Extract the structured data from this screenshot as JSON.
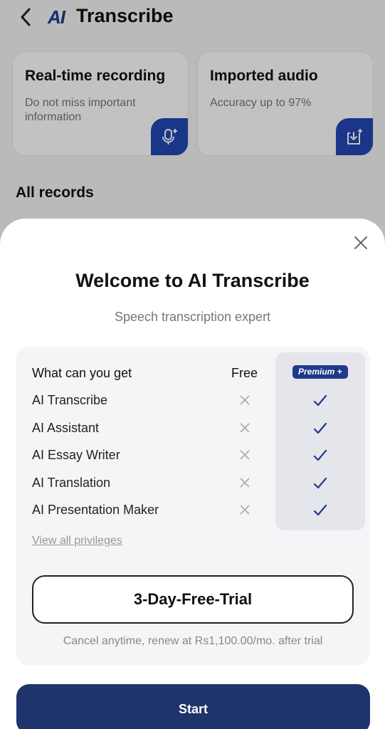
{
  "header": {
    "back_icon": "chevron-left-icon",
    "logo_text": "AI",
    "title": "Transcribe"
  },
  "cards": [
    {
      "title": "Real-time recording",
      "subtitle": "Do not miss important information",
      "icon": "mic-plus-icon"
    },
    {
      "title": "Imported audio",
      "subtitle": "Accuracy up to 97%",
      "icon": "import-plus-icon"
    }
  ],
  "records": {
    "title": "All records"
  },
  "sheet": {
    "close_icon": "close-icon",
    "title": "Welcome to AI Transcribe",
    "subtitle": "Speech transcription expert",
    "table": {
      "header": {
        "feature": "What can you get",
        "free": "Free",
        "premium": "Premium +"
      },
      "rows": [
        {
          "feature": "AI Transcribe",
          "free": false,
          "premium": true
        },
        {
          "feature": "AI Assistant",
          "free": false,
          "premium": true
        },
        {
          "feature": "AI Essay Writer",
          "free": false,
          "premium": true
        },
        {
          "feature": "AI Translation",
          "free": false,
          "premium": true
        },
        {
          "feature": "AI Presentation Maker",
          "free": false,
          "premium": true
        }
      ]
    },
    "view_all": "View all privileges",
    "trial_button": "3-Day-Free-Trial",
    "note": "Cancel anytime, renew at Rs1,100.00/mo. after trial",
    "start_button": "Start"
  },
  "colors": {
    "brand": "#1f3a8a",
    "start_button": "#1f346b",
    "card_action": "#2348b5"
  }
}
